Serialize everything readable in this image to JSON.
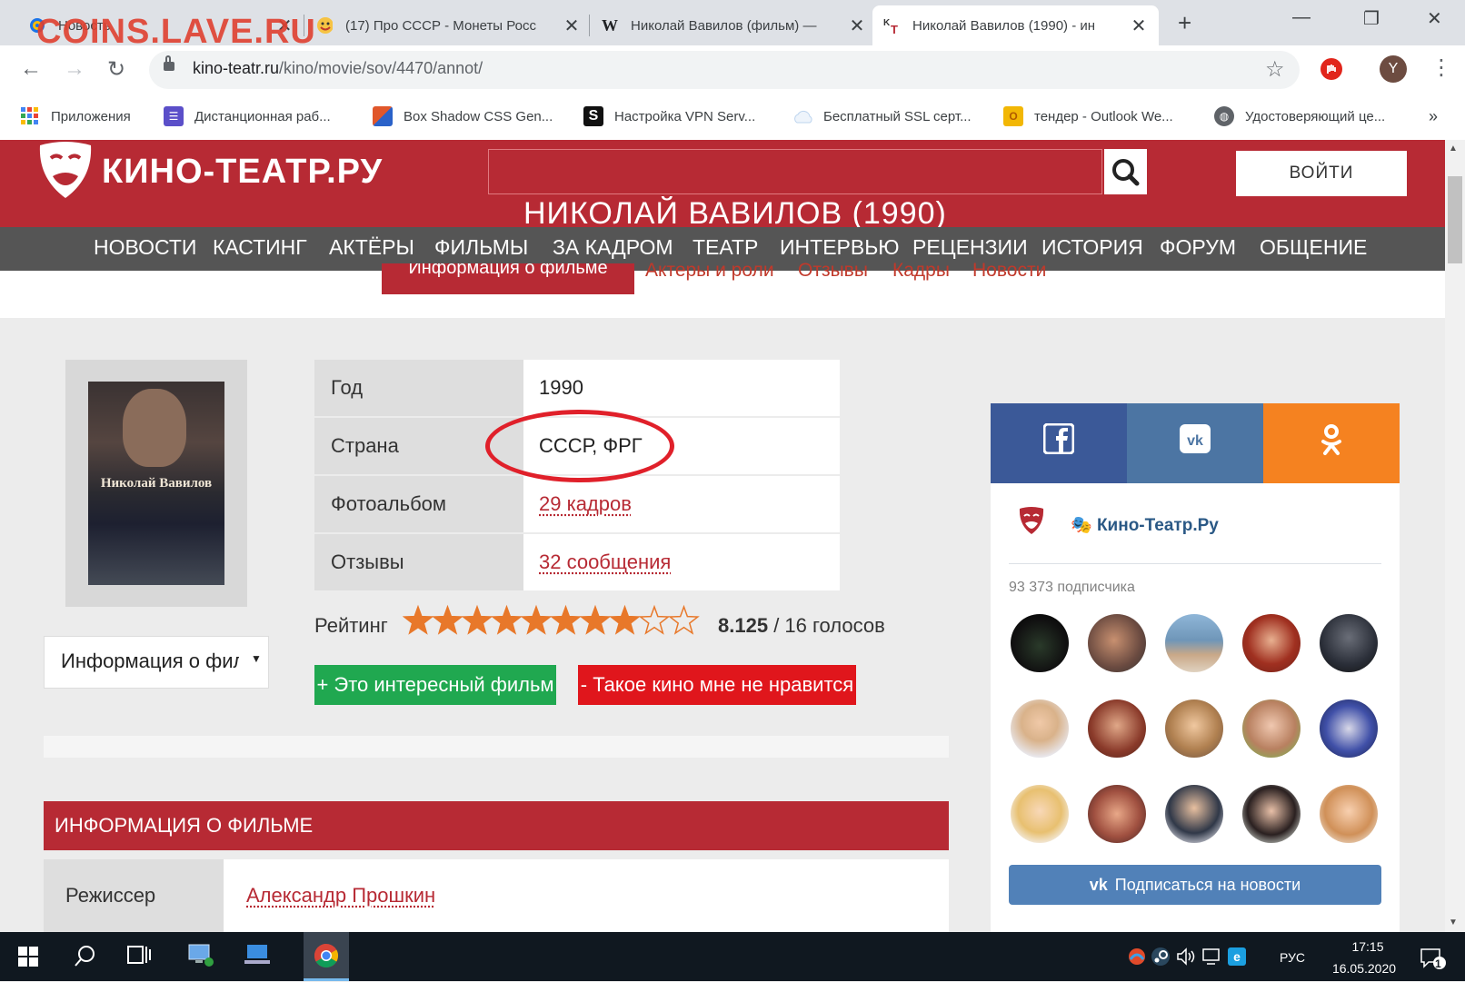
{
  "browser": {
    "tabs": [
      {
        "title": "Новость",
        "icon": "target-icon"
      },
      {
        "title": "(17) Про СССР - Монеты Росс",
        "icon": "emoji-icon"
      },
      {
        "title": "Николай Вавилов (фильм) —",
        "icon": "wikipedia-icon"
      },
      {
        "title": "Николай Вавилов (1990) - ин",
        "icon": "kino-teatr-icon",
        "active": true
      }
    ],
    "watermark": "COINS.LAVE.RU",
    "url_host": "kino-teatr.ru",
    "url_path": "/kino/movie/sov/4470/annot/",
    "profile_initial": "Y",
    "bookmarks": [
      {
        "label": "Приложения",
        "color": "#4285f4"
      },
      {
        "label": "Дистанционная раб...",
        "color": "#5b4fc9"
      },
      {
        "label": "Box Shadow CSS Gen...",
        "color": "#e0572b"
      },
      {
        "label": "Настройка VPN Serv...",
        "color": "#111111"
      },
      {
        "label": "Бесплатный SSL серт...",
        "color": "#bcd4ee"
      },
      {
        "label": "тендер - Outlook We...",
        "color": "#f2b705"
      },
      {
        "label": "Удостоверяющий це...",
        "color": "#5f6368"
      }
    ],
    "bookmarks_more": "»"
  },
  "site": {
    "logo": "КИНО-ТЕАТР.РУ",
    "login": "ВОЙТИ",
    "page_title": "НИКОЛАЙ ВАВИЛОВ (1990)",
    "nav": [
      "НОВОСТИ",
      "КАСТИНГ",
      "АКТЁРЫ",
      "ФИЛЬМЫ",
      "ЗА КАДРОМ",
      "ТЕАТР",
      "ИНТЕРВЬЮ",
      "РЕЦЕНЗИИ",
      "ИСТОРИЯ",
      "ФОРУМ",
      "ОБЩЕНИЕ"
    ],
    "subnav": {
      "active": "Информация о фильме",
      "items": [
        "Актеры и роли",
        "Отзывы",
        "Кадры",
        "Новости"
      ]
    }
  },
  "movie": {
    "poster_title": "Николай Вавилов",
    "select_value": "Информация о фил",
    "info": [
      {
        "label": "Год",
        "value": "1990",
        "link": false
      },
      {
        "label": "Страна",
        "value": "СССР, ФРГ",
        "link": false
      },
      {
        "label": "Фотоальбом",
        "value": "29 кадров",
        "link": true
      },
      {
        "label": "Отзывы",
        "value": "32 сообщения",
        "link": true
      }
    ],
    "rating_label": "Рейтинг",
    "rating_value": "8.125",
    "rating_votes": "/ 16 голосов",
    "rating_fraction": 0.8125,
    "like_button": "+ Это интересный фильм",
    "dislike_button": "- Такое кино мне не нравится",
    "section_title": "ИНФОРМАЦИЯ О ФИЛЬМЕ",
    "director_label": "Режиссер",
    "director_value": "Александр Прошкин"
  },
  "social": {
    "share": [
      {
        "name": "facebook",
        "color": "#3b5998",
        "glyph": "f"
      },
      {
        "name": "vkontakte",
        "color": "#4c75a3",
        "glyph": "vk"
      },
      {
        "name": "odnoklassniki",
        "color": "#f58220",
        "glyph": "ok"
      }
    ],
    "vk_group": "Кино-Театр.Ру",
    "vk_subscribers": "93 373 подписчика",
    "vk_subscribe": "Подписаться на новости"
  },
  "taskbar": {
    "lang": "РУС",
    "time": "17:15",
    "date": "16.05.2020",
    "notifications": "1"
  },
  "colors": {
    "site_red": "#b72a34",
    "nav_gray": "#555555",
    "like_green": "#20a850",
    "dislike_red": "#e0161c",
    "star_orange": "#e8782a",
    "annotation_red": "#e0202a",
    "vk_blue": "#5181b8"
  }
}
